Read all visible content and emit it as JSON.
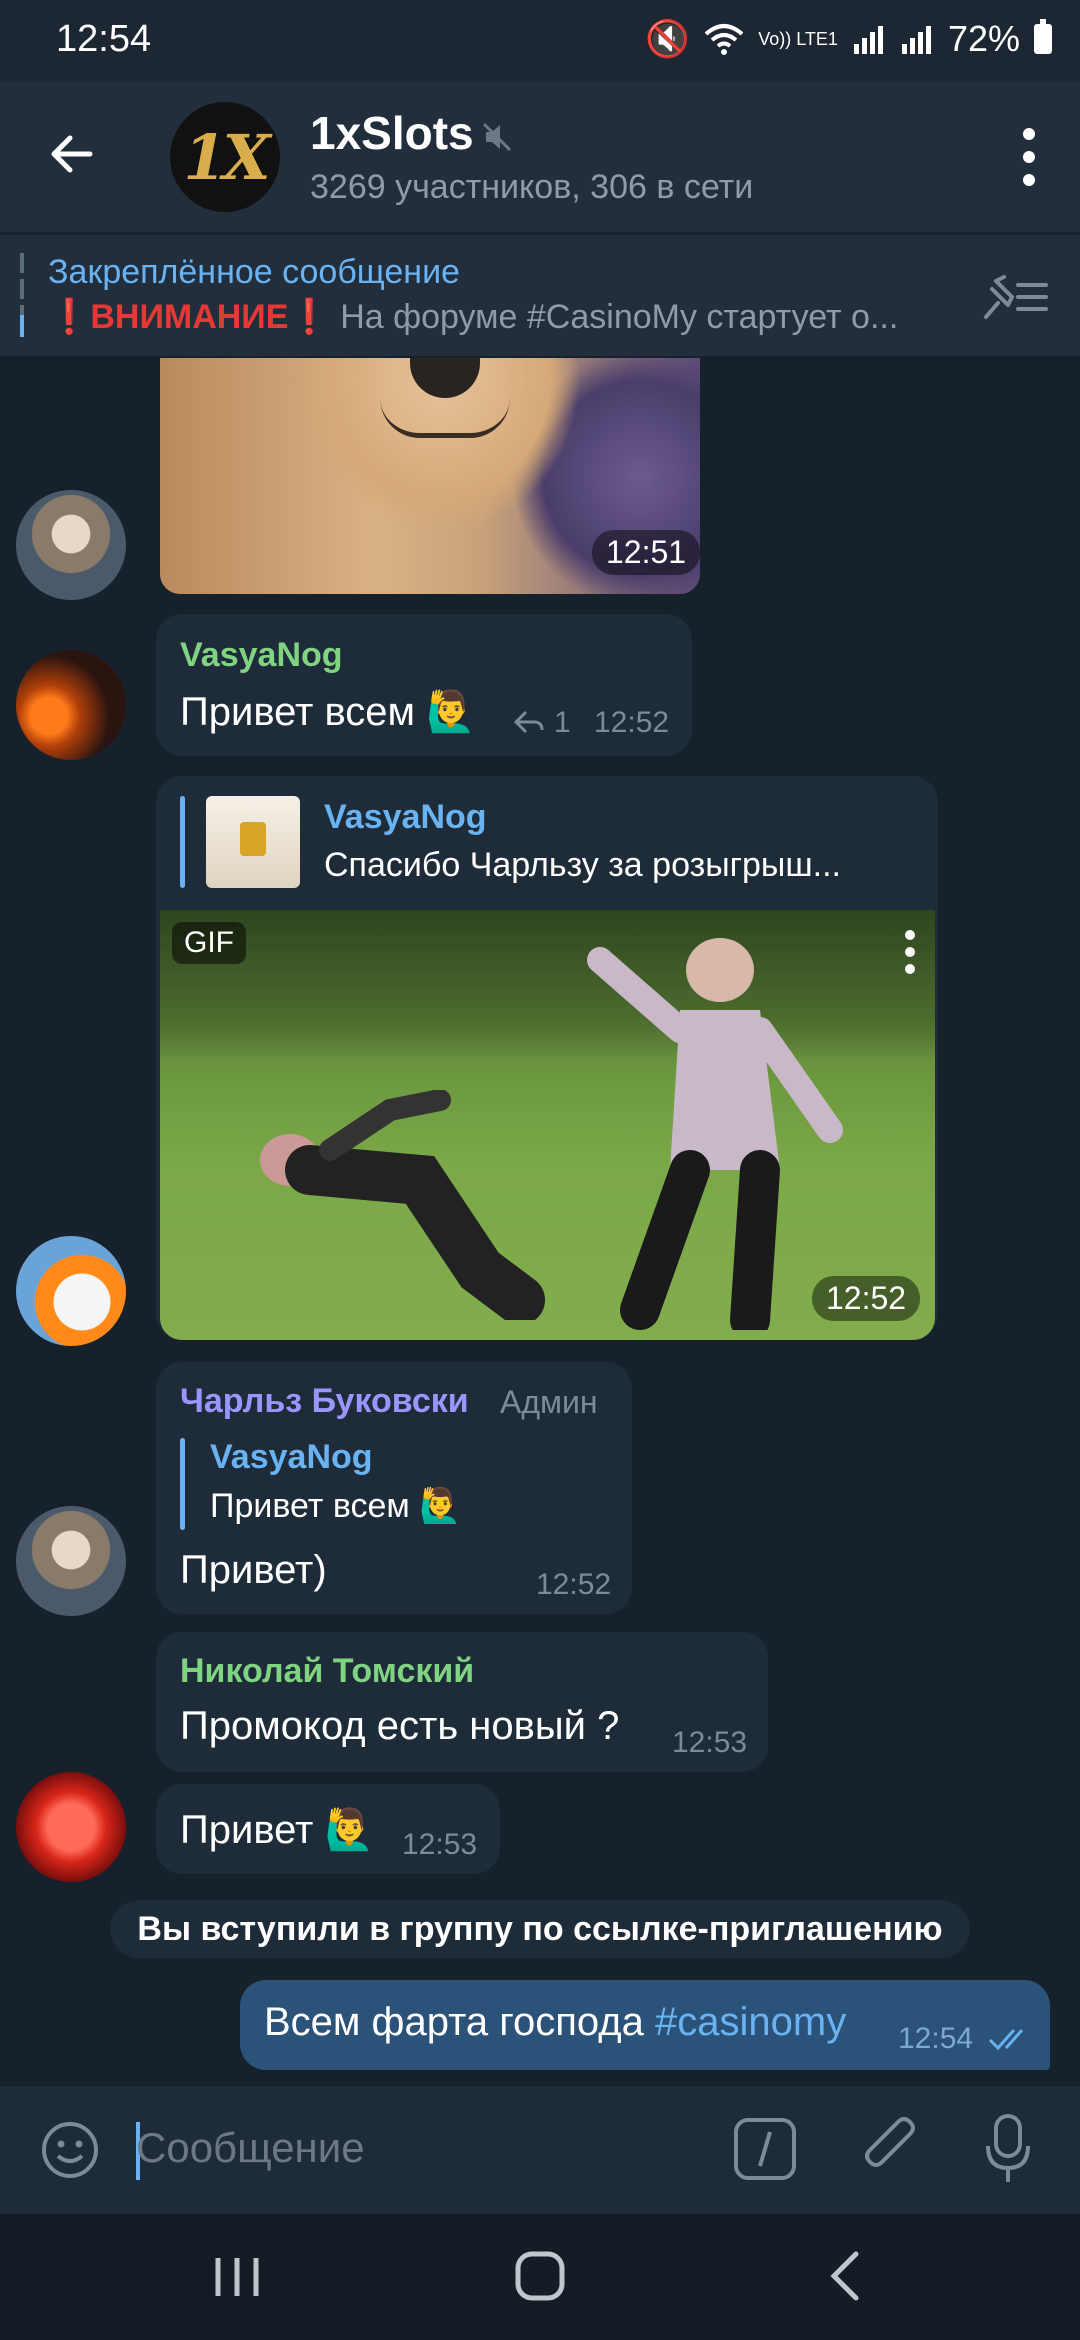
{
  "status_bar": {
    "time": "12:54",
    "network": "Vo)) LTE1",
    "battery": "72%"
  },
  "header": {
    "title": "1xSlots",
    "subtitle": "3269 участников, 306 в сети",
    "avatar_text": "1X"
  },
  "pinned": {
    "title": "Закреплённое сообщение",
    "text_prefix": "❗ВНИМАНИЕ❗",
    "text": "На форуме #CasinoMy стартует о..."
  },
  "messages": {
    "photo_time": "12:51",
    "m1": {
      "sender": "VasyaNog",
      "text": "Привет всем 🙋‍♂️",
      "replies": "1",
      "time": "12:52"
    },
    "m2": {
      "reply_sender": "VasyaNog",
      "reply_text": "Спасибо Чарльзу за розыгрыш...",
      "gif_label": "GIF",
      "time": "12:52"
    },
    "m3": {
      "sender": "Чарльз Буковски",
      "role": "Админ",
      "reply_sender": "VasyaNog",
      "reply_text": "Привет всем 🙋‍♂️",
      "text": "Привет)",
      "time": "12:52"
    },
    "m4": {
      "sender": "Николай Томский",
      "text": "Промокод есть новый ?",
      "time": "12:53"
    },
    "m5": {
      "text": "Привет 🙋‍♂️",
      "time": "12:53"
    },
    "service": "Вы вступили в группу по ссылке-приглашению",
    "out": {
      "text": "Всем фарта господа",
      "hashtag": "#casinomy",
      "time": "12:54"
    }
  },
  "composer": {
    "placeholder": "Сообщение"
  },
  "colors": {
    "accent": "#6ab3f3",
    "green_name": "#7fd381",
    "violet_name": "#9d95ff",
    "bg": "#17212b",
    "bubble": "#1e2c3a",
    "out_bubble": "#2b5278"
  }
}
